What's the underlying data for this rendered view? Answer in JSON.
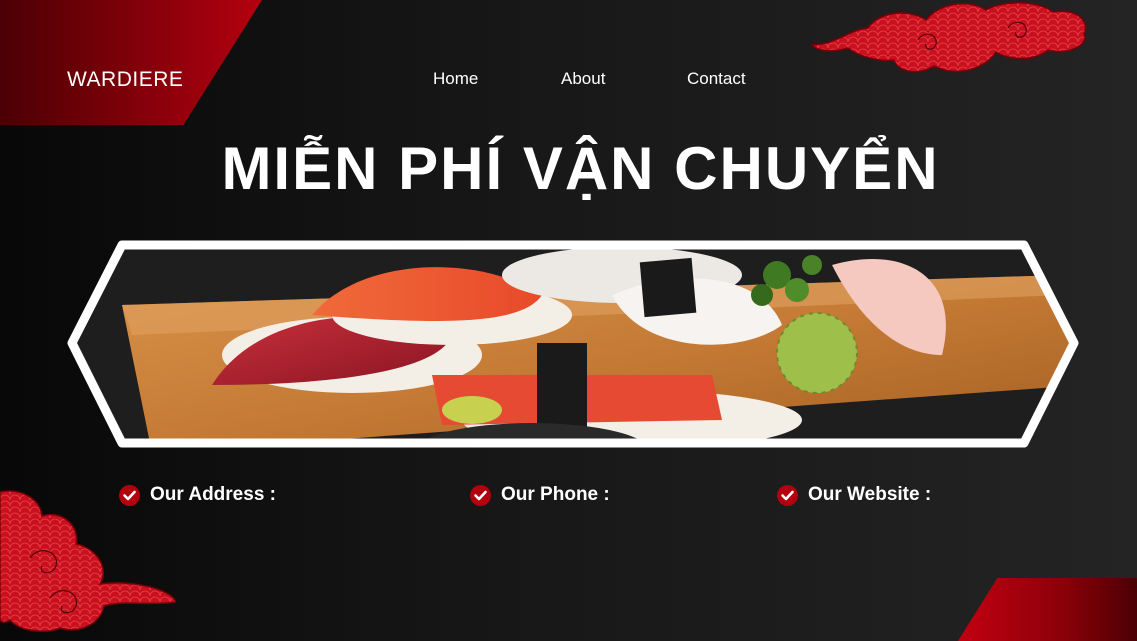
{
  "brand": {
    "name": "WARDIERE"
  },
  "nav": {
    "items": [
      "Home",
      "About",
      "Contact"
    ]
  },
  "hero": {
    "title": "MIỄN PHÍ VẬN CHUYỂN"
  },
  "features": [
    {
      "label": "Our Address :",
      "icon": "check-circle-icon"
    },
    {
      "label": "Our Phone :",
      "icon": "check-circle-icon"
    },
    {
      "label": "Our Website :",
      "icon": "check-circle-icon"
    }
  ],
  "colors": {
    "accent": "#b3000f",
    "background": "#1a1a1a",
    "text": "#ffffff"
  }
}
